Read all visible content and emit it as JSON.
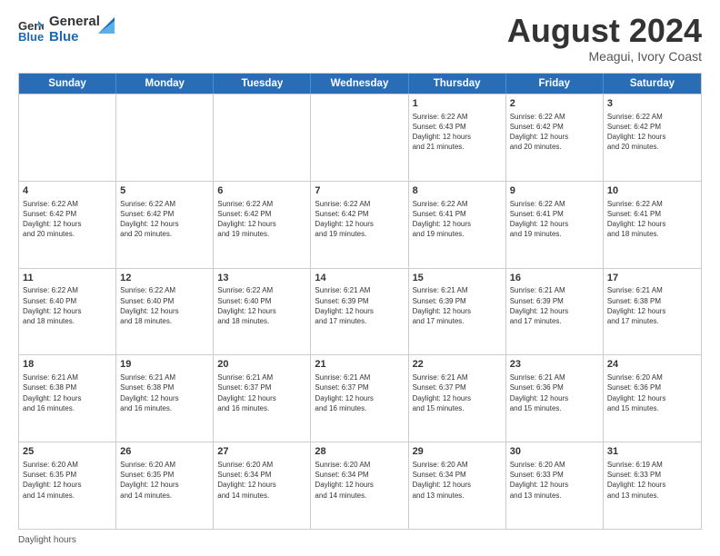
{
  "logo": {
    "line1": "General",
    "line2": "Blue"
  },
  "title": "August 2024",
  "subtitle": "Meagui, Ivory Coast",
  "days_of_week": [
    "Sunday",
    "Monday",
    "Tuesday",
    "Wednesday",
    "Thursday",
    "Friday",
    "Saturday"
  ],
  "footer": "Daylight hours",
  "weeks": [
    [
      {
        "day": "",
        "info": ""
      },
      {
        "day": "",
        "info": ""
      },
      {
        "day": "",
        "info": ""
      },
      {
        "day": "",
        "info": ""
      },
      {
        "day": "1",
        "info": "Sunrise: 6:22 AM\nSunset: 6:43 PM\nDaylight: 12 hours\nand 21 minutes."
      },
      {
        "day": "2",
        "info": "Sunrise: 6:22 AM\nSunset: 6:42 PM\nDaylight: 12 hours\nand 20 minutes."
      },
      {
        "day": "3",
        "info": "Sunrise: 6:22 AM\nSunset: 6:42 PM\nDaylight: 12 hours\nand 20 minutes."
      }
    ],
    [
      {
        "day": "4",
        "info": "Sunrise: 6:22 AM\nSunset: 6:42 PM\nDaylight: 12 hours\nand 20 minutes."
      },
      {
        "day": "5",
        "info": "Sunrise: 6:22 AM\nSunset: 6:42 PM\nDaylight: 12 hours\nand 20 minutes."
      },
      {
        "day": "6",
        "info": "Sunrise: 6:22 AM\nSunset: 6:42 PM\nDaylight: 12 hours\nand 19 minutes."
      },
      {
        "day": "7",
        "info": "Sunrise: 6:22 AM\nSunset: 6:42 PM\nDaylight: 12 hours\nand 19 minutes."
      },
      {
        "day": "8",
        "info": "Sunrise: 6:22 AM\nSunset: 6:41 PM\nDaylight: 12 hours\nand 19 minutes."
      },
      {
        "day": "9",
        "info": "Sunrise: 6:22 AM\nSunset: 6:41 PM\nDaylight: 12 hours\nand 19 minutes."
      },
      {
        "day": "10",
        "info": "Sunrise: 6:22 AM\nSunset: 6:41 PM\nDaylight: 12 hours\nand 18 minutes."
      }
    ],
    [
      {
        "day": "11",
        "info": "Sunrise: 6:22 AM\nSunset: 6:40 PM\nDaylight: 12 hours\nand 18 minutes."
      },
      {
        "day": "12",
        "info": "Sunrise: 6:22 AM\nSunset: 6:40 PM\nDaylight: 12 hours\nand 18 minutes."
      },
      {
        "day": "13",
        "info": "Sunrise: 6:22 AM\nSunset: 6:40 PM\nDaylight: 12 hours\nand 18 minutes."
      },
      {
        "day": "14",
        "info": "Sunrise: 6:21 AM\nSunset: 6:39 PM\nDaylight: 12 hours\nand 17 minutes."
      },
      {
        "day": "15",
        "info": "Sunrise: 6:21 AM\nSunset: 6:39 PM\nDaylight: 12 hours\nand 17 minutes."
      },
      {
        "day": "16",
        "info": "Sunrise: 6:21 AM\nSunset: 6:39 PM\nDaylight: 12 hours\nand 17 minutes."
      },
      {
        "day": "17",
        "info": "Sunrise: 6:21 AM\nSunset: 6:38 PM\nDaylight: 12 hours\nand 17 minutes."
      }
    ],
    [
      {
        "day": "18",
        "info": "Sunrise: 6:21 AM\nSunset: 6:38 PM\nDaylight: 12 hours\nand 16 minutes."
      },
      {
        "day": "19",
        "info": "Sunrise: 6:21 AM\nSunset: 6:38 PM\nDaylight: 12 hours\nand 16 minutes."
      },
      {
        "day": "20",
        "info": "Sunrise: 6:21 AM\nSunset: 6:37 PM\nDaylight: 12 hours\nand 16 minutes."
      },
      {
        "day": "21",
        "info": "Sunrise: 6:21 AM\nSunset: 6:37 PM\nDaylight: 12 hours\nand 16 minutes."
      },
      {
        "day": "22",
        "info": "Sunrise: 6:21 AM\nSunset: 6:37 PM\nDaylight: 12 hours\nand 15 minutes."
      },
      {
        "day": "23",
        "info": "Sunrise: 6:21 AM\nSunset: 6:36 PM\nDaylight: 12 hours\nand 15 minutes."
      },
      {
        "day": "24",
        "info": "Sunrise: 6:20 AM\nSunset: 6:36 PM\nDaylight: 12 hours\nand 15 minutes."
      }
    ],
    [
      {
        "day": "25",
        "info": "Sunrise: 6:20 AM\nSunset: 6:35 PM\nDaylight: 12 hours\nand 14 minutes."
      },
      {
        "day": "26",
        "info": "Sunrise: 6:20 AM\nSunset: 6:35 PM\nDaylight: 12 hours\nand 14 minutes."
      },
      {
        "day": "27",
        "info": "Sunrise: 6:20 AM\nSunset: 6:34 PM\nDaylight: 12 hours\nand 14 minutes."
      },
      {
        "day": "28",
        "info": "Sunrise: 6:20 AM\nSunset: 6:34 PM\nDaylight: 12 hours\nand 14 minutes."
      },
      {
        "day": "29",
        "info": "Sunrise: 6:20 AM\nSunset: 6:34 PM\nDaylight: 12 hours\nand 13 minutes."
      },
      {
        "day": "30",
        "info": "Sunrise: 6:20 AM\nSunset: 6:33 PM\nDaylight: 12 hours\nand 13 minutes."
      },
      {
        "day": "31",
        "info": "Sunrise: 6:19 AM\nSunset: 6:33 PM\nDaylight: 12 hours\nand 13 minutes."
      }
    ]
  ]
}
